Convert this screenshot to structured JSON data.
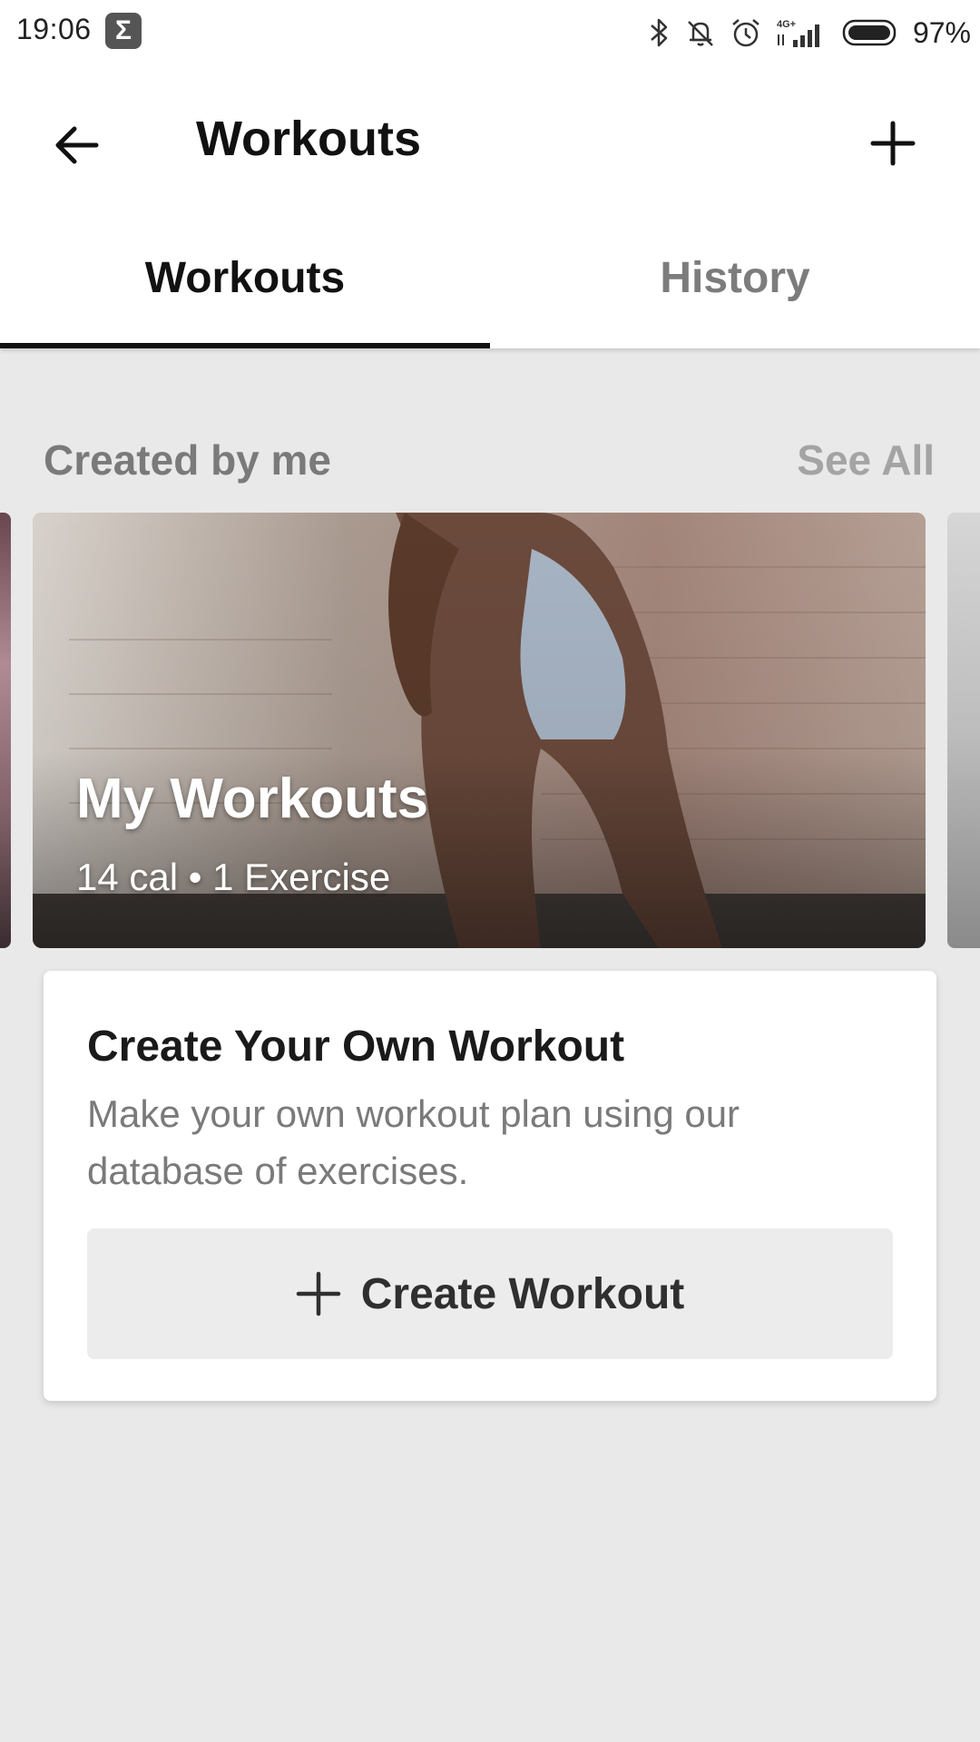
{
  "status_bar": {
    "time": "19:06",
    "battery": "97%",
    "icons": [
      "sigma-icon",
      "bluetooth-icon",
      "muted-bell-icon",
      "alarm-icon",
      "signal-4g-icon",
      "battery-icon"
    ],
    "network_label": "4G+"
  },
  "app_bar": {
    "title": "Workouts",
    "back_icon": "arrow-left-icon",
    "add_icon": "plus-icon"
  },
  "tabs": [
    {
      "label": "Workouts",
      "active": true
    },
    {
      "label": "History",
      "active": false
    }
  ],
  "section": {
    "title": "Created by me",
    "see_all": "See All"
  },
  "workout_card": {
    "title": "My Workouts",
    "meta": "14 cal • 1 Exercise"
  },
  "create_card": {
    "title": "Create Your Own Workout",
    "description": "Make your own workout plan using our database of exercises.",
    "button_label": "Create Workout",
    "button_icon": "plus-icon"
  },
  "colors": {
    "background": "#e9e9e9",
    "surface": "#ffffff",
    "tab_indicator": "#111111",
    "muted_text": "#7a7a7a"
  }
}
